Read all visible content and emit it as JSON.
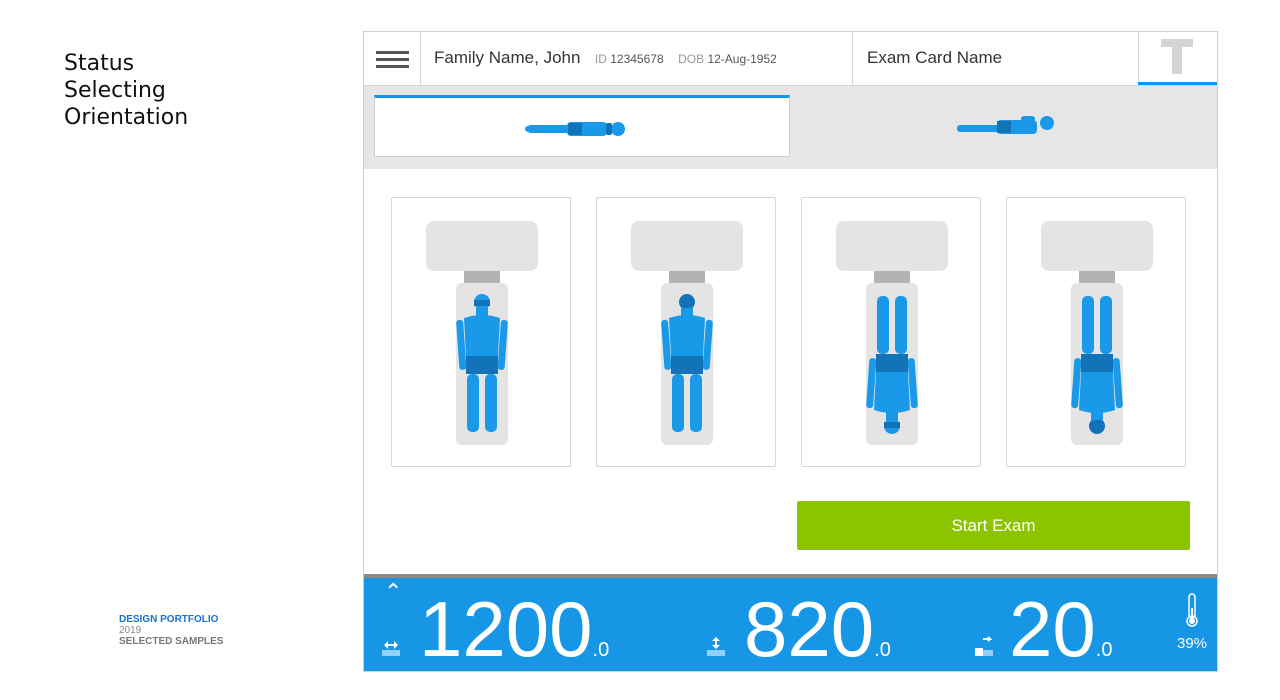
{
  "status_panel": {
    "line1": "Status",
    "line2": "Selecting",
    "line3": "Orientation"
  },
  "portfolio": {
    "title": "DESIGN PORTFOLIO",
    "year": "2019",
    "subtitle": "SELECTED SAMPLES"
  },
  "header": {
    "patient_name": "Family Name, John",
    "id_label": "ID",
    "id_value": "12345678",
    "dob_label": "DOB",
    "dob_value": "12-Aug-1952",
    "exam_card": "Exam Card Name"
  },
  "orientation_tabs": [
    {
      "icon": "patient-supine-icon",
      "active": true
    },
    {
      "icon": "patient-prone-icon",
      "active": false
    }
  ],
  "position_cards": [
    {
      "icon": "head-first-supine-icon"
    },
    {
      "icon": "head-first-prone-icon"
    },
    {
      "icon": "feet-first-supine-icon"
    },
    {
      "icon": "feet-first-prone-icon"
    }
  ],
  "start_button": "Start Exam",
  "readouts": [
    {
      "icon": "horizontal-position-icon",
      "value": "1200",
      "decimal": ".0"
    },
    {
      "icon": "vertical-position-icon",
      "value": "820",
      "decimal": ".0"
    },
    {
      "icon": "tilt-angle-icon",
      "value": "20",
      "decimal": ".0"
    }
  ],
  "temperature": {
    "icon": "thermometer-icon",
    "value": "39%"
  },
  "colors": {
    "accent_blue": "#1896e6",
    "body_blue": "#1a99e8",
    "body_dark": "#1273b8",
    "start_green": "#8cc400",
    "tab_gray": "#e6e6e6"
  }
}
